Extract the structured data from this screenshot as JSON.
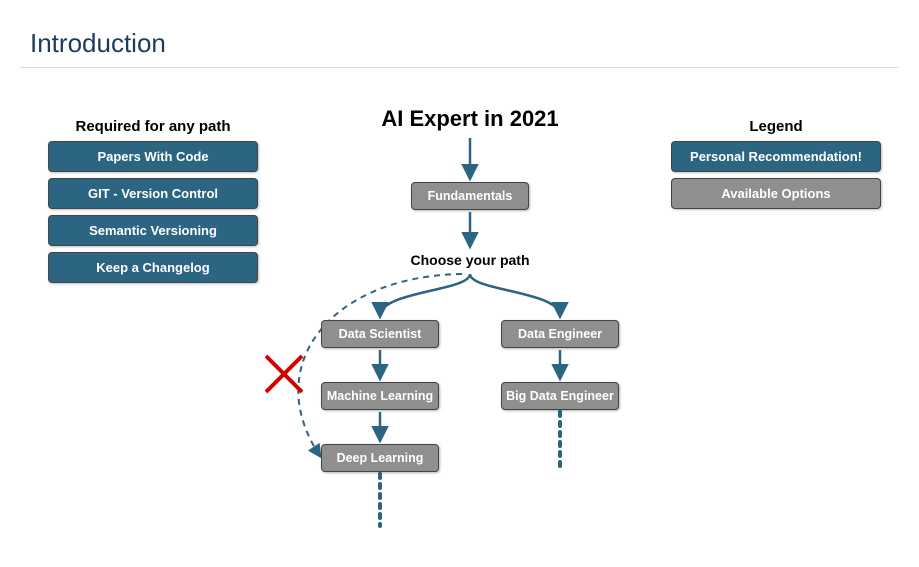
{
  "title": "Introduction",
  "required": {
    "heading": "Required for any path",
    "items": [
      "Papers With Code",
      "GIT - Version Control",
      "Semantic Versioning",
      "Keep a Changelog"
    ]
  },
  "legend": {
    "heading": "Legend",
    "recommended": "Personal Recommendation!",
    "available": "Available Options"
  },
  "diagram": {
    "title": "AI Expert in 2021",
    "fundamentals": "Fundamentals",
    "choose": "Choose your path",
    "left_path": [
      "Data Scientist",
      "Machine Learning",
      "Deep Learning"
    ],
    "right_path": [
      "Data Engineer",
      "Big Data Engineer"
    ]
  },
  "colors": {
    "blue": "#2b6582",
    "gray": "#8f8f8f",
    "arrow": "#2b6582",
    "red": "#d40000"
  }
}
